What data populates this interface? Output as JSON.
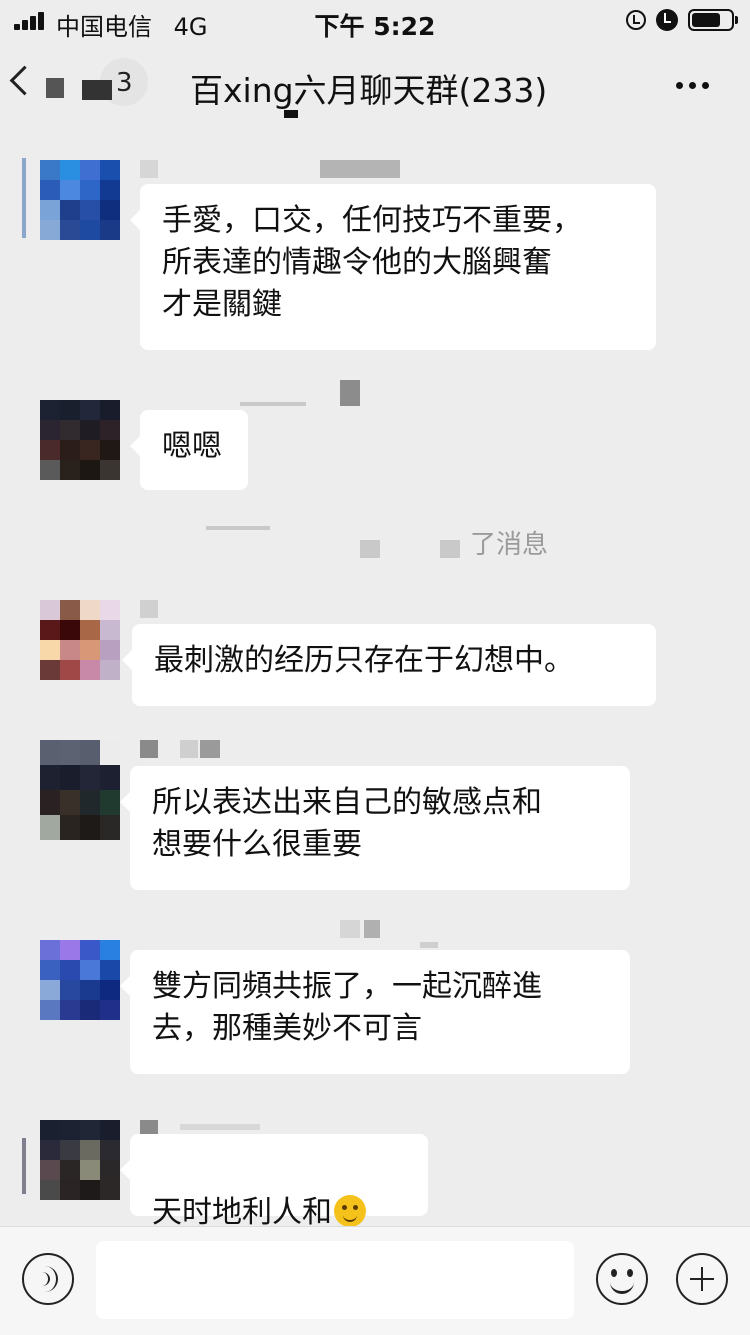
{
  "status_bar": {
    "carrier": "中国电信",
    "network": "4G",
    "time": "下午 5:22",
    "icons": [
      "signal-icon",
      "rotation-lock-icon",
      "alarm-icon",
      "battery-icon"
    ]
  },
  "nav": {
    "unread_count": "3",
    "title": "百xing六月聊天群(233)",
    "more_icon": "more-icon",
    "back_icon": "back-chevron-icon"
  },
  "messages": [
    {
      "text": "手愛，口交，任何技巧不重要，\n所表達的情趣令他的大腦興奮\n才是關鍵"
    },
    {
      "text": "嗯嗯"
    },
    {
      "text": "最刺激的经历只存在于幻想中。"
    },
    {
      "text": "所以表达出来自己的敏感点和\n想要什么很重要"
    },
    {
      "text": "雙方同頻共振了，一起沉醉進\n去，那種美妙不可言"
    },
    {
      "text": "天时地利人和",
      "emoji": "thinking-face-emoji"
    }
  ],
  "system_notice": "了消息",
  "input_bar": {
    "value": "",
    "voice_icon": "voice-icon",
    "emoji_icon": "emoji-icon",
    "plus_icon": "plus-icon"
  },
  "colors": {
    "background": "#ededed",
    "bubble": "#ffffff",
    "text": "#111111",
    "system_text": "#9a9a9a"
  }
}
